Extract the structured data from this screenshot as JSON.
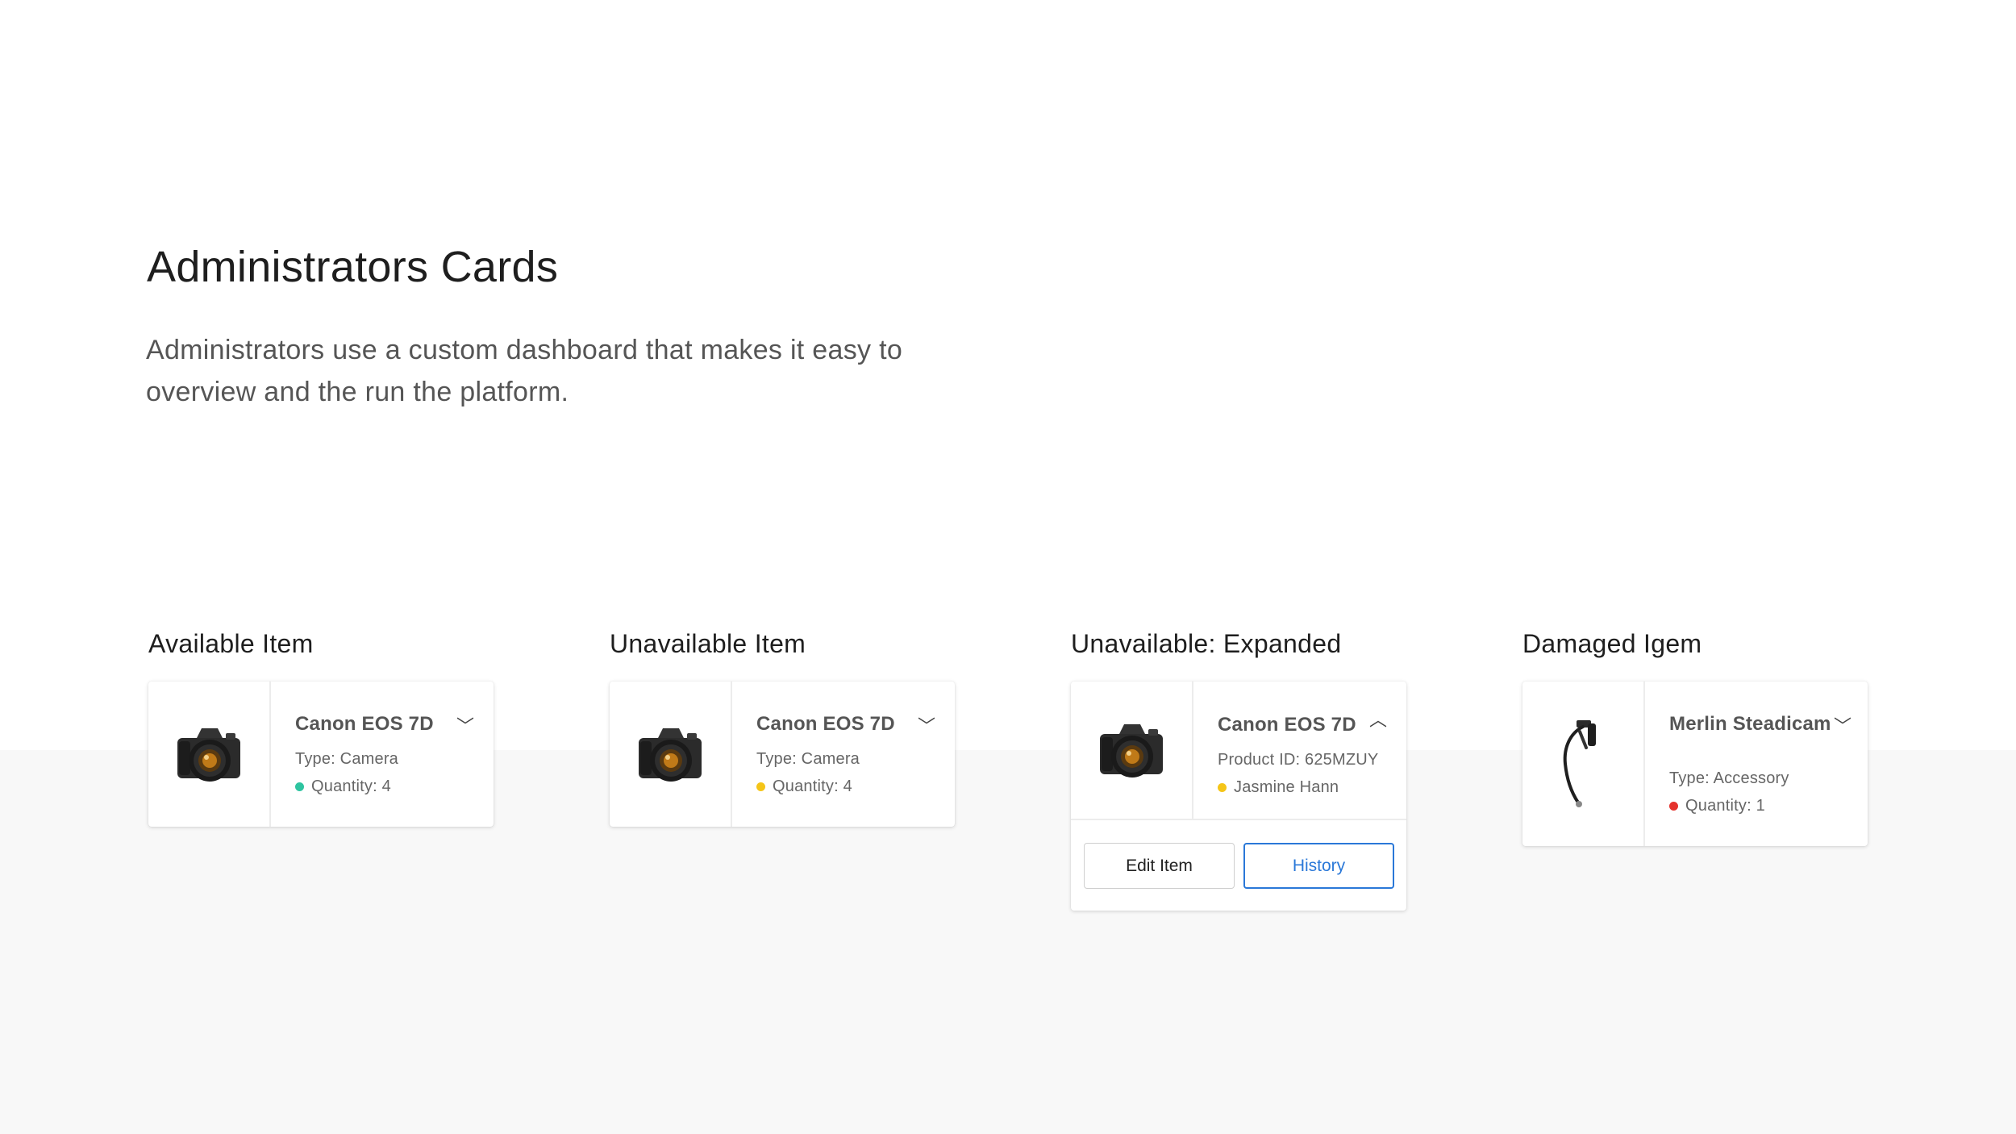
{
  "page": {
    "title": "Administrators Cards",
    "description": "Administrators use a custom dashboard that makes it easy to overview and the run the platform."
  },
  "colors": {
    "available": "#2ec4a0",
    "unavailable": "#f5c518",
    "damaged": "#e5322d",
    "accent": "#2a78d8"
  },
  "cards": [
    {
      "section_label": "Available Item",
      "name": "Canon EOS 7D",
      "type": "Type: Camera",
      "quantity": "Quantity: 4",
      "status": "available",
      "image_icon": "camera-icon",
      "toggle_icon": "chevron-down-icon"
    },
    {
      "section_label": "Unavailable Item",
      "name": "Canon EOS 7D",
      "type": "Type: Camera",
      "quantity": "Quantity: 4",
      "status": "unavailable",
      "image_icon": "camera-icon",
      "toggle_icon": "chevron-down-icon"
    },
    {
      "section_label": "Unavailable: Expanded",
      "name": "Canon EOS 7D",
      "product_id": "Product ID: 625MZUY",
      "assignee": "Jasmine Hann",
      "status": "unavailable",
      "image_icon": "camera-icon",
      "toggle_icon": "chevron-up-icon",
      "edit_label": "Edit Item",
      "history_label": "History"
    },
    {
      "section_label": "Damaged Igem",
      "name": "Merlin Steadicam",
      "type": "Type: Accessory",
      "quantity": "Quantity: 1",
      "status": "damaged",
      "image_icon": "steadicam-icon",
      "toggle_icon": "chevron-down-icon"
    }
  ]
}
